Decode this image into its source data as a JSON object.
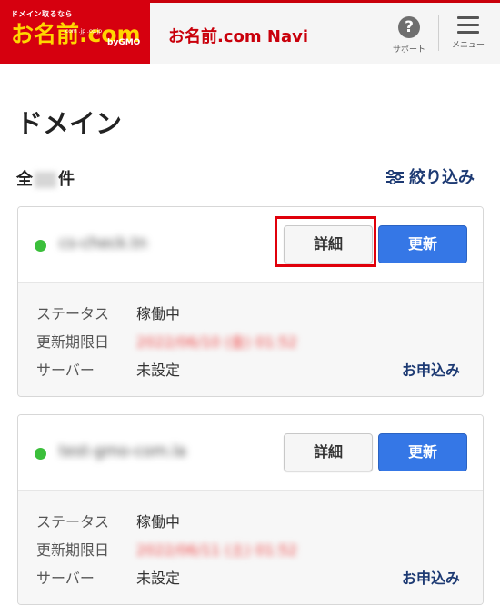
{
  "header": {
    "logo_top": "ドメイン取るなら",
    "logo_main": "お名前.com",
    "logo_sub": ".com .jp .co.jp",
    "logo_gmo": "byGMO",
    "title": "お名前.com Navi",
    "support_label": "サポート",
    "menu_label": "メニュー"
  },
  "page": {
    "title": "ドメイン",
    "count_prefix": "全",
    "count_suffix": "件",
    "filter_label": "絞り込み"
  },
  "labels": {
    "status": "ステータス",
    "expiry": "更新期限日",
    "server": "サーバー"
  },
  "domains": [
    {
      "name": "cs-check.tn",
      "status": "稼働中",
      "expiry": "2022/06/10 (金) 01:52",
      "server": "未設定",
      "detail_label": "詳細",
      "renew_label": "更新",
      "apply_label": "お申込み",
      "status_color": "#3bbf3b"
    },
    {
      "name": "test-gmo-com.la",
      "status": "稼働中",
      "expiry": "2022/06/11 (土) 01:52",
      "server": "未設定",
      "detail_label": "詳細",
      "renew_label": "更新",
      "apply_label": "お申込み",
      "status_color": "#3bbf3b"
    }
  ],
  "colors": {
    "brand_red": "#d6000f",
    "logo_yellow": "#ffd600",
    "accent_blue": "#3577e6",
    "link_navy": "#1d3a73",
    "highlight_red": "#e0000b"
  }
}
